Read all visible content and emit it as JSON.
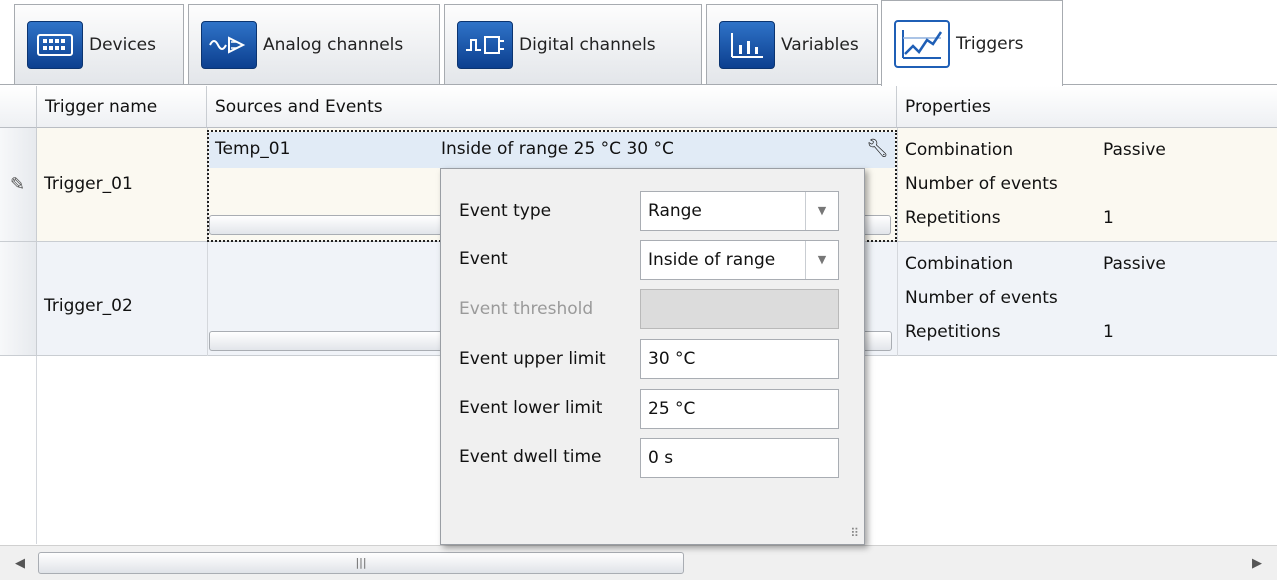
{
  "tabs": [
    {
      "label": "Devices",
      "icon": "devices-icon"
    },
    {
      "label": "Analog channels",
      "icon": "analog-channels-icon"
    },
    {
      "label": "Digital channels",
      "icon": "digital-channels-icon"
    },
    {
      "label": "Variables",
      "icon": "variables-icon"
    },
    {
      "label": "Triggers",
      "icon": "triggers-icon",
      "active": true
    }
  ],
  "grid": {
    "headers": {
      "name": "Trigger name",
      "sources": "Sources and Events",
      "properties": "Properties"
    },
    "rows": [
      {
        "name": "Trigger_01",
        "source": "Temp_01",
        "event": "Inside of range 25 °C 30 °C",
        "props": [
          {
            "key": "Combination",
            "value": "Passive"
          },
          {
            "key": "Number of events",
            "value": ""
          },
          {
            "key": "Repetitions",
            "value": "1"
          }
        ]
      },
      {
        "name": "Trigger_02",
        "props": [
          {
            "key": "Combination",
            "value": "Passive"
          },
          {
            "key": "Number of events",
            "value": ""
          },
          {
            "key": "Repetitions",
            "value": "1"
          }
        ]
      }
    ]
  },
  "popup": {
    "event_type": {
      "label": "Event type",
      "value": "Range"
    },
    "event": {
      "label": "Event",
      "value": "Inside of range"
    },
    "event_threshold": {
      "label": "Event threshold",
      "value": ""
    },
    "event_upper_limit": {
      "label": "Event upper limit",
      "value": "30 °C"
    },
    "event_lower_limit": {
      "label": "Event lower limit",
      "value": "25 °C"
    },
    "event_dwell_time": {
      "label": "Event dwell time",
      "value": "0 s"
    }
  },
  "colors": {
    "accent": "#1f5fb6",
    "selected_row": "#fbf9f1",
    "source_highlight": "#e1ebf6"
  }
}
